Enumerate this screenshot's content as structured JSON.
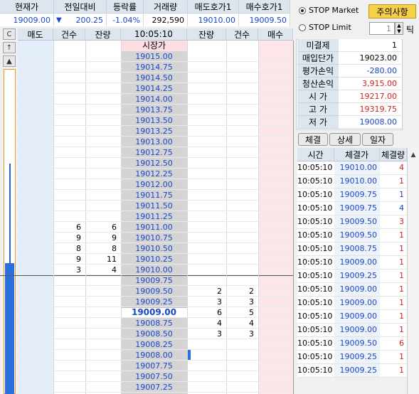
{
  "quote": {
    "headers": [
      "현재가",
      "전일대비",
      "등락률",
      "거래량",
      "매도호가1",
      "매수호가1"
    ],
    "current_price": "19009.00",
    "change_arrow": "▼",
    "change": "200.25",
    "change_rate": "-1.04%",
    "volume": "292,590",
    "ask1": "19010.00",
    "bid1": "19009.50"
  },
  "stop": {
    "market_label": "STOP Market",
    "limit_label": "STOP Limit",
    "notice_button": "주의사항",
    "tick_value": "1",
    "tick_unit": "틱"
  },
  "orderbook": {
    "side_buttons": [
      "C",
      "↑",
      "▲"
    ],
    "headers": [
      "매도",
      "건수",
      "잔량",
      "10:05:10",
      "잔량",
      "건수",
      "매수"
    ],
    "market_label": "시장가",
    "current_price": "19009.00",
    "rows": [
      {
        "price": "19015.00",
        "sc": "",
        "sq": "",
        "bq": "",
        "bc": ""
      },
      {
        "price": "19014.75",
        "sc": "",
        "sq": "",
        "bq": "",
        "bc": ""
      },
      {
        "price": "19014.50",
        "sc": "",
        "sq": "",
        "bq": "",
        "bc": ""
      },
      {
        "price": "19014.25",
        "sc": "",
        "sq": "",
        "bq": "",
        "bc": ""
      },
      {
        "price": "19014.00",
        "sc": "",
        "sq": "",
        "bq": "",
        "bc": ""
      },
      {
        "price": "19013.75",
        "sc": "",
        "sq": "",
        "bq": "",
        "bc": ""
      },
      {
        "price": "19013.50",
        "sc": "",
        "sq": "",
        "bq": "",
        "bc": ""
      },
      {
        "price": "19013.25",
        "sc": "",
        "sq": "",
        "bq": "",
        "bc": ""
      },
      {
        "price": "19013.00",
        "sc": "",
        "sq": "",
        "bq": "",
        "bc": ""
      },
      {
        "price": "19012.75",
        "sc": "",
        "sq": "",
        "bq": "",
        "bc": ""
      },
      {
        "price": "19012.50",
        "sc": "",
        "sq": "",
        "bq": "",
        "bc": ""
      },
      {
        "price": "19012.25",
        "sc": "",
        "sq": "",
        "bq": "",
        "bc": ""
      },
      {
        "price": "19012.00",
        "sc": "",
        "sq": "",
        "bq": "",
        "bc": ""
      },
      {
        "price": "19011.75",
        "sc": "",
        "sq": "",
        "bq": "",
        "bc": ""
      },
      {
        "price": "19011.50",
        "sc": "",
        "sq": "",
        "bq": "",
        "bc": ""
      },
      {
        "price": "19011.25",
        "sc": "",
        "sq": "",
        "bq": "",
        "bc": ""
      },
      {
        "price": "19011.00",
        "sc": "6",
        "sq": "6",
        "bq": "",
        "bc": ""
      },
      {
        "price": "19010.75",
        "sc": "9",
        "sq": "9",
        "bq": "",
        "bc": ""
      },
      {
        "price": "19010.50",
        "sc": "8",
        "sq": "8",
        "bq": "",
        "bc": ""
      },
      {
        "price": "19010.25",
        "sc": "9",
        "sq": "11",
        "bq": "",
        "bc": ""
      },
      {
        "price": "19010.00",
        "sc": "3",
        "sq": "4",
        "bq": "",
        "bc": ""
      },
      {
        "price": "19009.75",
        "sc": "",
        "sq": "",
        "bq": "",
        "bc": ""
      },
      {
        "price": "19009.50",
        "sc": "",
        "sq": "",
        "bq": "2",
        "bc": "2"
      },
      {
        "price": "19009.25",
        "sc": "",
        "sq": "",
        "bq": "3",
        "bc": "3"
      },
      {
        "price": "19009.00",
        "sc": "",
        "sq": "",
        "bq": "6",
        "bc": "5"
      },
      {
        "price": "19008.75",
        "sc": "",
        "sq": "",
        "bq": "4",
        "bc": "4"
      },
      {
        "price": "19008.50",
        "sc": "",
        "sq": "",
        "bq": "3",
        "bc": "3"
      },
      {
        "price": "19008.25",
        "sc": "",
        "sq": "",
        "bq": "",
        "bc": ""
      },
      {
        "price": "19008.00",
        "sc": "",
        "sq": "",
        "bq": "",
        "bc": ""
      },
      {
        "price": "19007.75",
        "sc": "",
        "sq": "",
        "bq": "",
        "bc": ""
      },
      {
        "price": "19007.50",
        "sc": "",
        "sq": "",
        "bq": "",
        "bc": ""
      },
      {
        "price": "19007.25",
        "sc": "",
        "sq": "",
        "bq": "",
        "bc": ""
      }
    ]
  },
  "info": [
    {
      "label": "미결제",
      "value": "1",
      "color": "#000000"
    },
    {
      "label": "매입단가",
      "value": "19023.00",
      "color": "#000000"
    },
    {
      "label": "평가손익",
      "value": "-280.00",
      "color": "#1a47c8"
    },
    {
      "label": "청산손익",
      "value": "3,915.00",
      "color": "#d42020"
    },
    {
      "label": "시 가",
      "value": "19217.00",
      "color": "#d42020"
    },
    {
      "label": "고 가",
      "value": "19319.75",
      "color": "#d42020"
    },
    {
      "label": "저 가",
      "value": "19008.00",
      "color": "#1a47c8"
    }
  ],
  "tabs": [
    "체결",
    "상세",
    "일자"
  ],
  "trades": {
    "headers": [
      "시간",
      "체결가",
      "체결량"
    ],
    "rows": [
      {
        "time": "10:05:10",
        "price": "19010.00",
        "qty": "4",
        "pc": "#1a47c8",
        "qc": "#d42020"
      },
      {
        "time": "10:05:10",
        "price": "19010.00",
        "qty": "1",
        "pc": "#1a47c8",
        "qc": "#d42020"
      },
      {
        "time": "10:05:10",
        "price": "19009.75",
        "qty": "1",
        "pc": "#1a47c8",
        "qc": "#1a47c8"
      },
      {
        "time": "10:05:10",
        "price": "19009.75",
        "qty": "4",
        "pc": "#1a47c8",
        "qc": "#1a47c8"
      },
      {
        "time": "10:05:10",
        "price": "19009.50",
        "qty": "3",
        "pc": "#1a47c8",
        "qc": "#d42020"
      },
      {
        "time": "10:05:10",
        "price": "19009.50",
        "qty": "1",
        "pc": "#1a47c8",
        "qc": "#d42020"
      },
      {
        "time": "10:05:10",
        "price": "19008.75",
        "qty": "1",
        "pc": "#1a47c8",
        "qc": "#d42020"
      },
      {
        "time": "10:05:10",
        "price": "19009.00",
        "qty": "1",
        "pc": "#1a47c8",
        "qc": "#d42020"
      },
      {
        "time": "10:05:10",
        "price": "19009.25",
        "qty": "1",
        "pc": "#1a47c8",
        "qc": "#d42020"
      },
      {
        "time": "10:05:10",
        "price": "19009.00",
        "qty": "1",
        "pc": "#1a47c8",
        "qc": "#d42020"
      },
      {
        "time": "10:05:10",
        "price": "19009.00",
        "qty": "1",
        "pc": "#1a47c8",
        "qc": "#d42020"
      },
      {
        "time": "10:05:10",
        "price": "19009.00",
        "qty": "1",
        "pc": "#1a47c8",
        "qc": "#d42020"
      },
      {
        "time": "10:05:10",
        "price": "19009.00",
        "qty": "1",
        "pc": "#1a47c8",
        "qc": "#d42020"
      },
      {
        "time": "10:05:10",
        "price": "19009.50",
        "qty": "6",
        "pc": "#1a47c8",
        "qc": "#d42020"
      },
      {
        "time": "10:05:10",
        "price": "19009.25",
        "qty": "1",
        "pc": "#1a47c8",
        "qc": "#d42020"
      },
      {
        "time": "10:05:10",
        "price": "19009.25",
        "qty": "1",
        "pc": "#1a47c8",
        "qc": "#d42020"
      }
    ]
  }
}
